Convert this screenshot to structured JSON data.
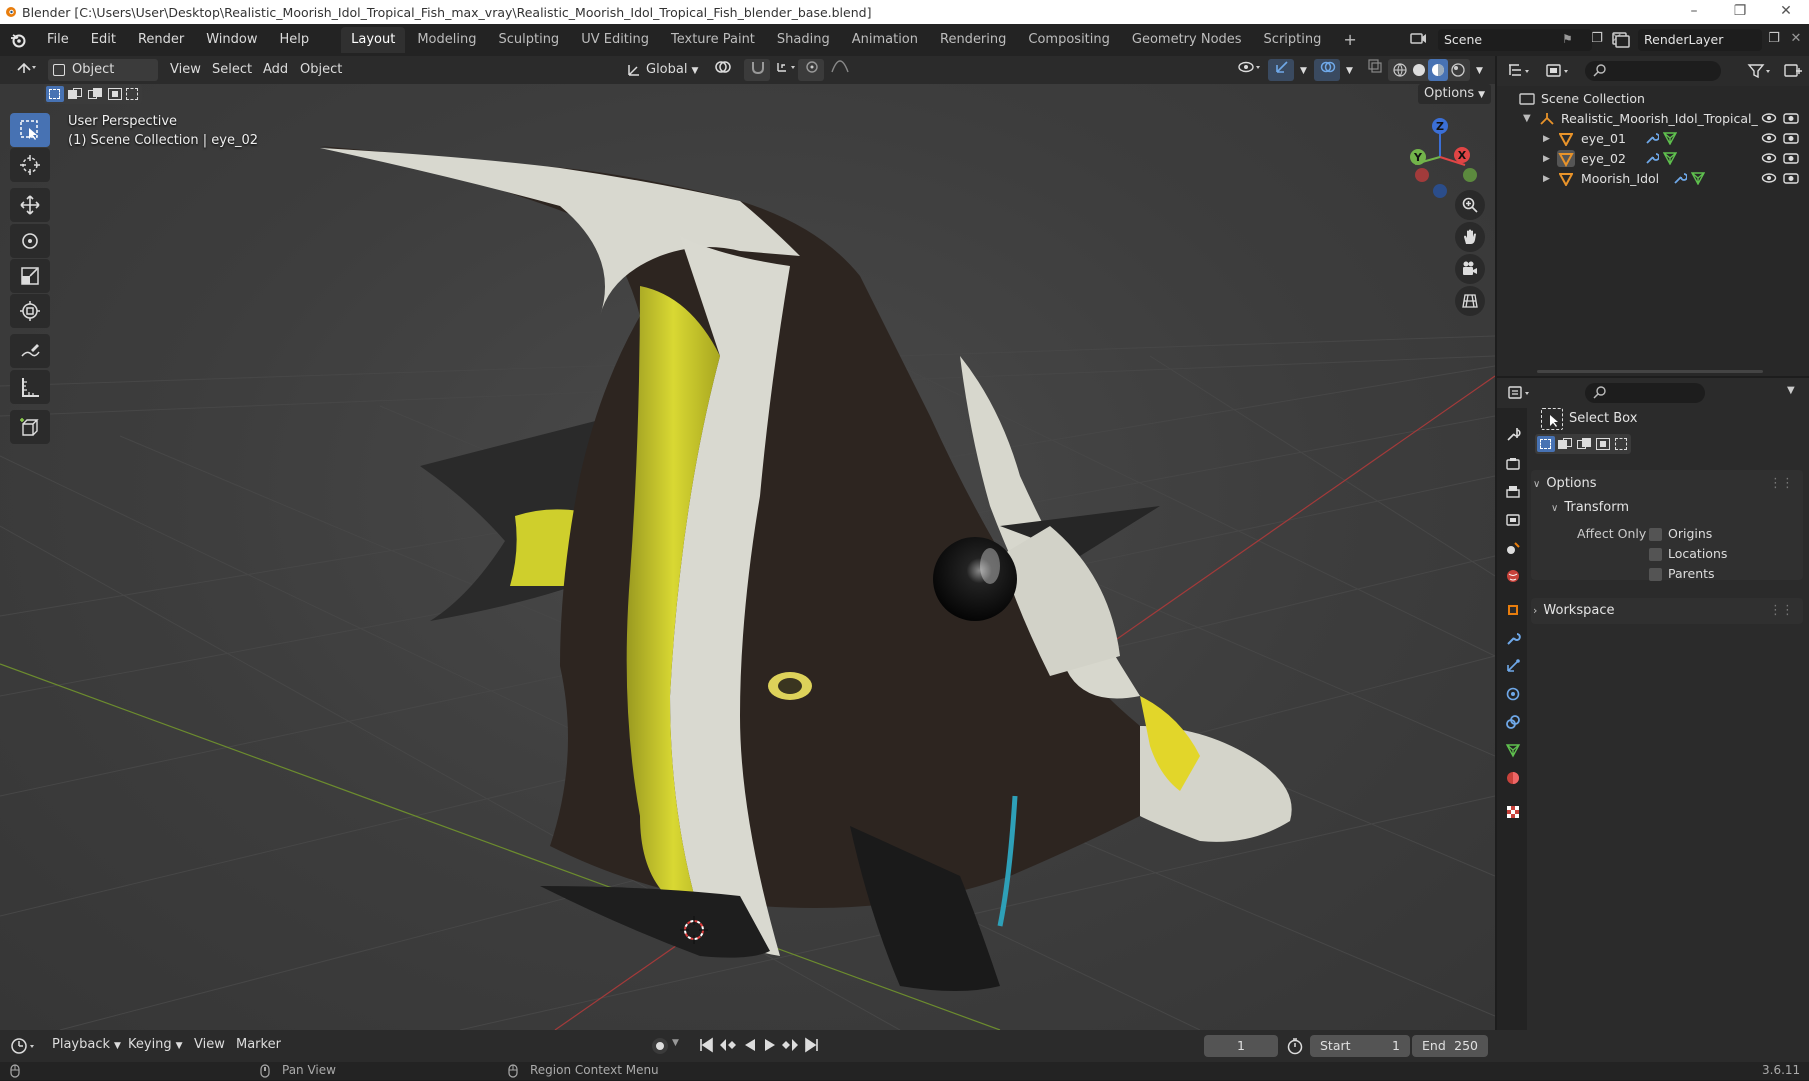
{
  "titlebar": {
    "title": "Blender [C:\\Users\\User\\Desktop\\Realistic_Moorish_Idol_Tropical_Fish_max_vray\\Realistic_Moorish_Idol_Tropical_Fish_blender_base.blend]"
  },
  "menu": [
    "File",
    "Edit",
    "Render",
    "Window",
    "Help"
  ],
  "workspaces": [
    "Layout",
    "Modeling",
    "Sculpting",
    "UV Editing",
    "Texture Paint",
    "Shading",
    "Animation",
    "Rendering",
    "Compositing",
    "Geometry Nodes",
    "Scripting"
  ],
  "active_workspace": "Layout",
  "scene": {
    "name": "Scene",
    "view_layer": "RenderLayer"
  },
  "viewport": {
    "mode": "Object Mode",
    "menus": [
      "View",
      "Select",
      "Add",
      "Object"
    ],
    "orientation": "Global",
    "options_label": "Options",
    "overlay_line1": "User Perspective",
    "overlay_line2": "(1) Scene Collection | eye_02",
    "gizmo": {
      "z": "Z",
      "y": "Y",
      "x": "X"
    }
  },
  "outliner": {
    "root": "Scene Collection",
    "collection": "Realistic_Moorish_Idol_Tropical_",
    "objects": [
      "eye_01",
      "eye_02",
      "Moorish_Idol"
    ]
  },
  "properties": {
    "tool_name": "Select Box",
    "options_header": "Options",
    "transform_header": "Transform",
    "affect_only_label": "Affect Only",
    "checkboxes": [
      "Origins",
      "Locations",
      "Parents"
    ],
    "workspace_header": "Workspace"
  },
  "timeline": {
    "menus": [
      "Playback",
      "Keying",
      "View",
      "Marker"
    ],
    "current_frame": "1",
    "start_label": "Start",
    "start": "1",
    "end_label": "End",
    "end": "250"
  },
  "statusbar": {
    "hint1": "Pan View",
    "hint2": "Region Context Menu",
    "version": "3.6.11"
  },
  "colors": {
    "accent": "#4772b3",
    "object_orange": "#e87d0d",
    "mesh_green": "#5fbf4e",
    "modifier_blue": "#6fa8e8"
  }
}
